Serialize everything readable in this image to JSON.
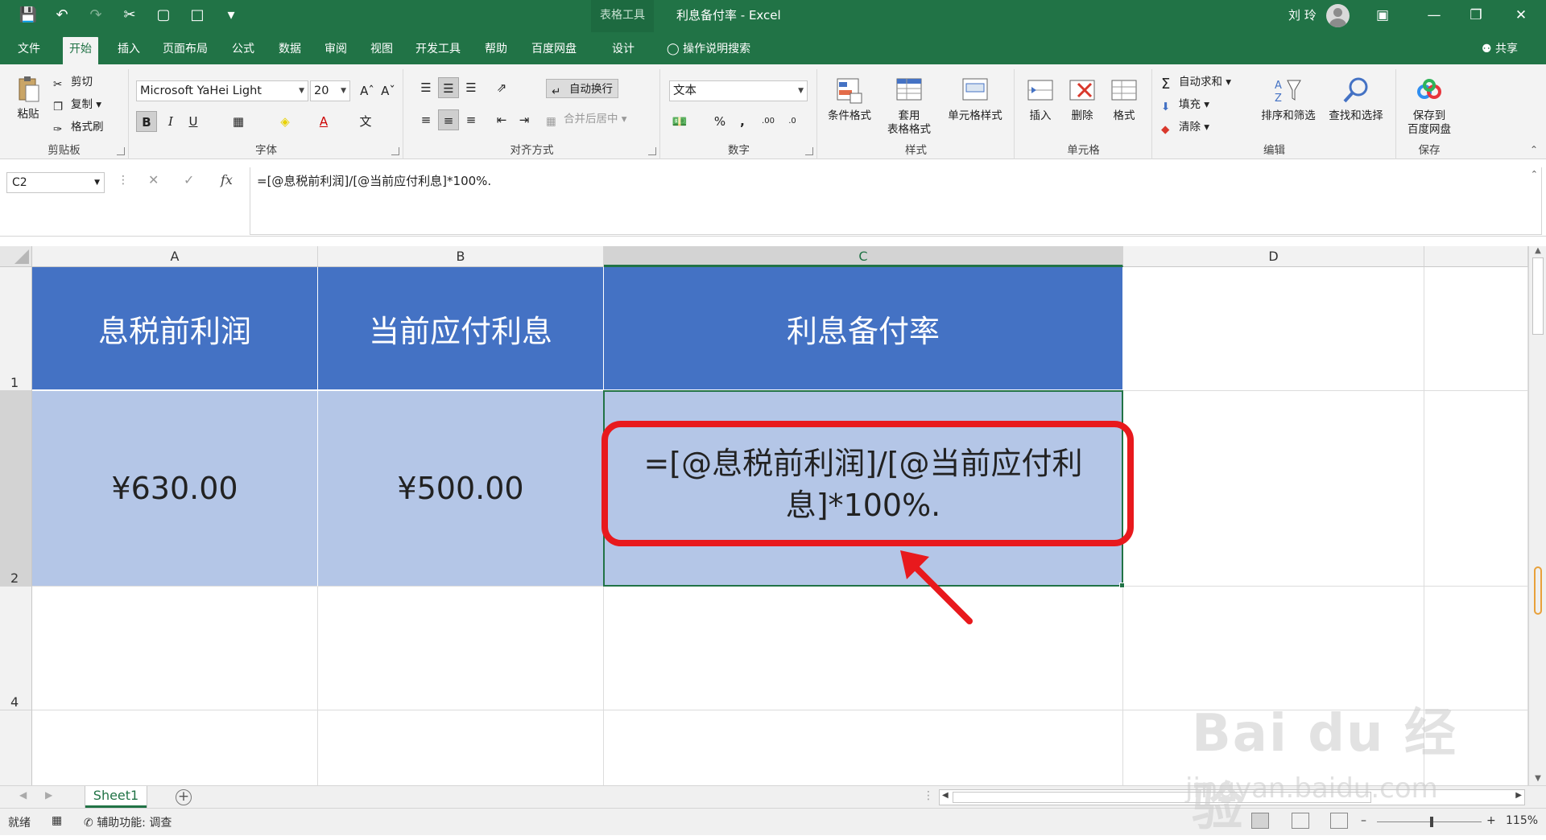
{
  "app": {
    "tool_context": "表格工具",
    "document_title": "利息备付率 - Excel",
    "user_name": "刘 玲"
  },
  "menu": {
    "tabs": [
      "文件",
      "开始",
      "插入",
      "页面布局",
      "公式",
      "数据",
      "审阅",
      "视图",
      "开发工具",
      "帮助",
      "百度网盘",
      "设计"
    ],
    "active_tab": "开始",
    "search_placeholder": "操作说明搜索",
    "share_label": "共享"
  },
  "ribbon": {
    "clipboard": {
      "paste": "粘贴",
      "cut": "剪切",
      "copy": "复制",
      "format_painter": "格式刷",
      "group_label": "剪贴板"
    },
    "font": {
      "font_name": "Microsoft YaHei Light",
      "font_size": "20",
      "bold": "B",
      "italic": "I",
      "underline": "U",
      "group_label": "字体"
    },
    "alignment": {
      "wrap_text": "自动换行",
      "merge_center": "合并后居中",
      "group_label": "对齐方式"
    },
    "number": {
      "format": "文本",
      "percent": "%",
      "comma": ",",
      "group_label": "数字"
    },
    "styles": {
      "conditional_format": "条件格式",
      "format_as_table_1": "套用",
      "format_as_table_2": "表格格式",
      "cell_styles": "单元格样式",
      "group_label": "样式"
    },
    "cells": {
      "insert": "插入",
      "delete": "删除",
      "format": "格式",
      "group_label": "单元格"
    },
    "editing": {
      "autosum": "自动求和",
      "fill": "填充",
      "clear": "清除",
      "sort_filter": "排序和筛选",
      "find_select": "查找和选择",
      "group_label": "编辑"
    },
    "save": {
      "save_to_1": "保存到",
      "save_to_2": "百度网盘",
      "group_label": "保存"
    }
  },
  "formula_bar": {
    "name_box": "C2",
    "fx": "fx",
    "formula": "=[@息税前利润]/[@当前应付利息]*100%."
  },
  "grid": {
    "columns": [
      "A",
      "B",
      "C",
      "D"
    ],
    "selected_column": "C",
    "rows": [
      "1",
      "2",
      "4"
    ],
    "header_cells": [
      "息税前利润",
      "当前应付利息",
      "利息备付率"
    ],
    "row2": {
      "a": "¥630.00",
      "b": "¥500.00",
      "c": "=[@息税前利润]/[@当前应付利息]*100%."
    },
    "colors": {
      "header_fill": "#4472c4",
      "data_fill": "#b4c6e7",
      "highlight": "#e8191d",
      "accent": "#217346"
    }
  },
  "sheets": {
    "tabs": [
      "Sheet1"
    ],
    "active": "Sheet1"
  },
  "status": {
    "ready": "就绪",
    "accessibility": "辅助功能: 调查",
    "zoom": "115%"
  },
  "watermark": {
    "logo": "Bai du 经验",
    "url": "jingyan.baidu.com"
  }
}
